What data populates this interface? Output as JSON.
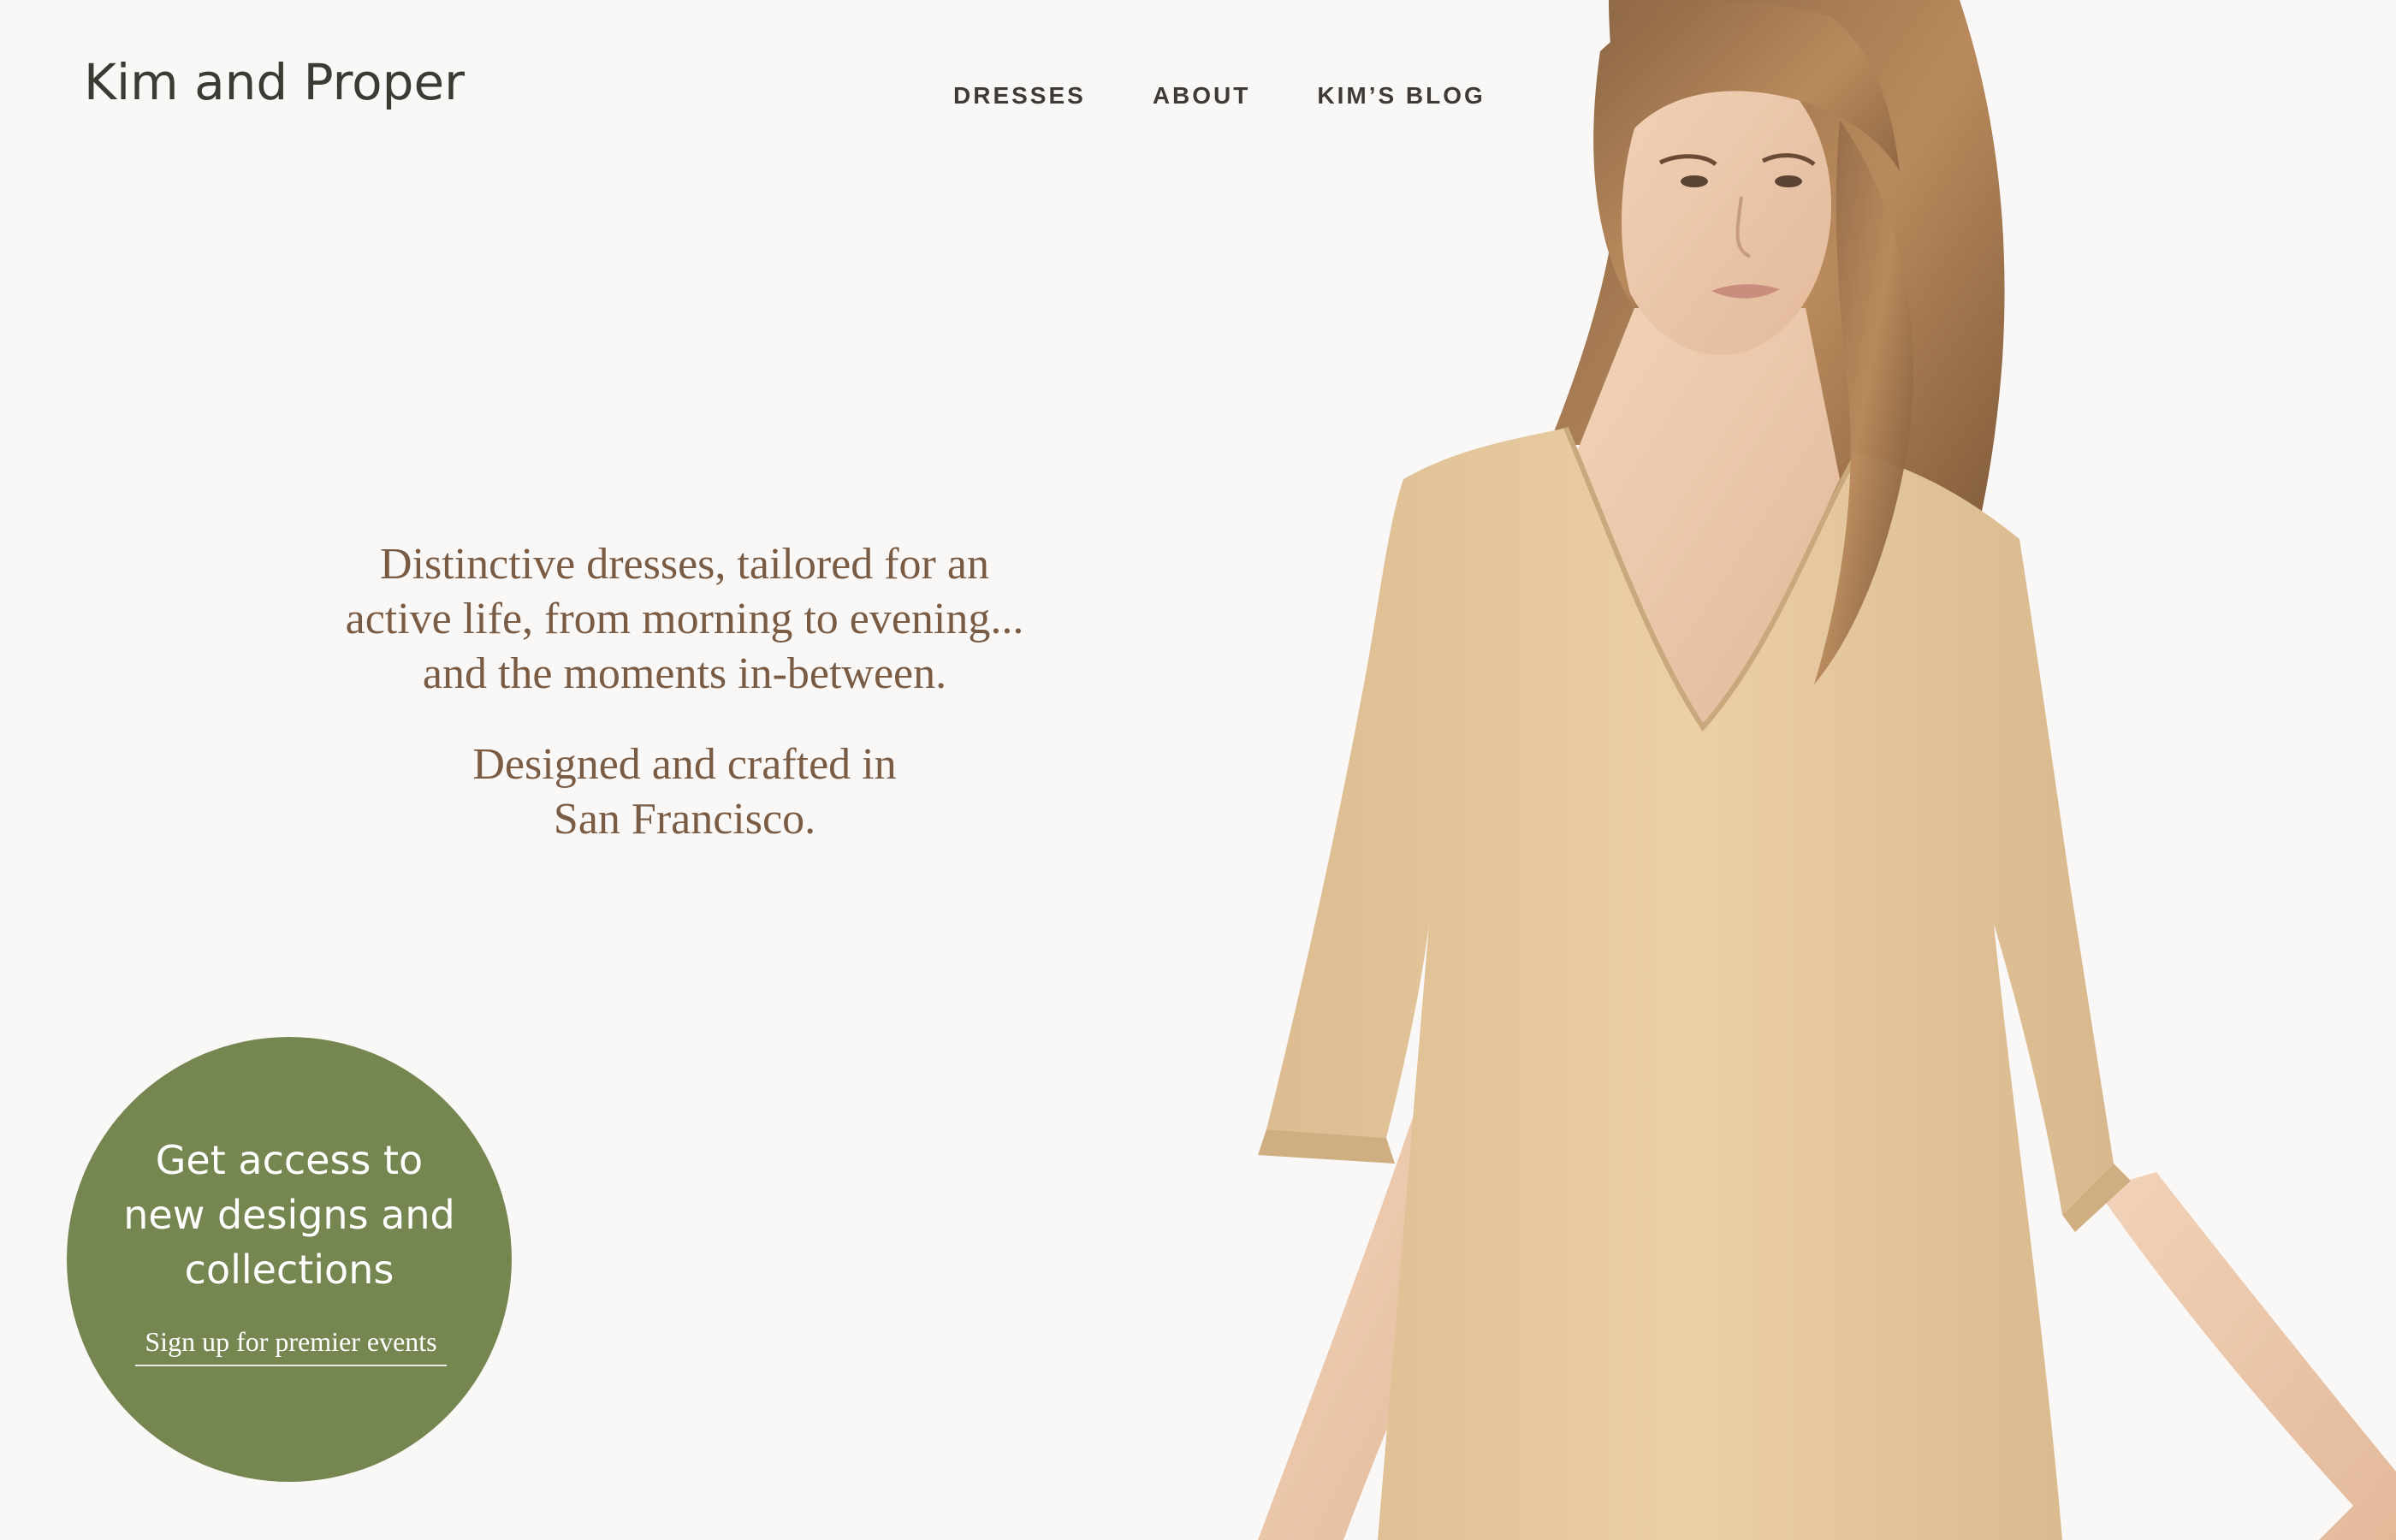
{
  "brand": {
    "logo_text": "Kim and Proper"
  },
  "nav": {
    "items": [
      {
        "label": "DRESSES"
      },
      {
        "label": "ABOUT"
      },
      {
        "label": "KIM’S BLOG"
      }
    ]
  },
  "hero": {
    "line1": "Distinctive dresses, tailored for an",
    "line2": "active life, from morning to evening...",
    "line3": "and the moments in-between.",
    "line4": "Designed and crafted in",
    "line5": "San Francisco."
  },
  "cta": {
    "title_line1": "Get access to",
    "title_line2": "new designs and",
    "title_line3": "collections",
    "link_label": "Sign up for premier  events"
  },
  "colors": {
    "background": "#faf8f7",
    "accent_green": "#768651",
    "text_brown": "#7a5c45",
    "dress": "#e6c9a0"
  },
  "image": {
    "icon": "model-in-beige-dress-photo"
  }
}
